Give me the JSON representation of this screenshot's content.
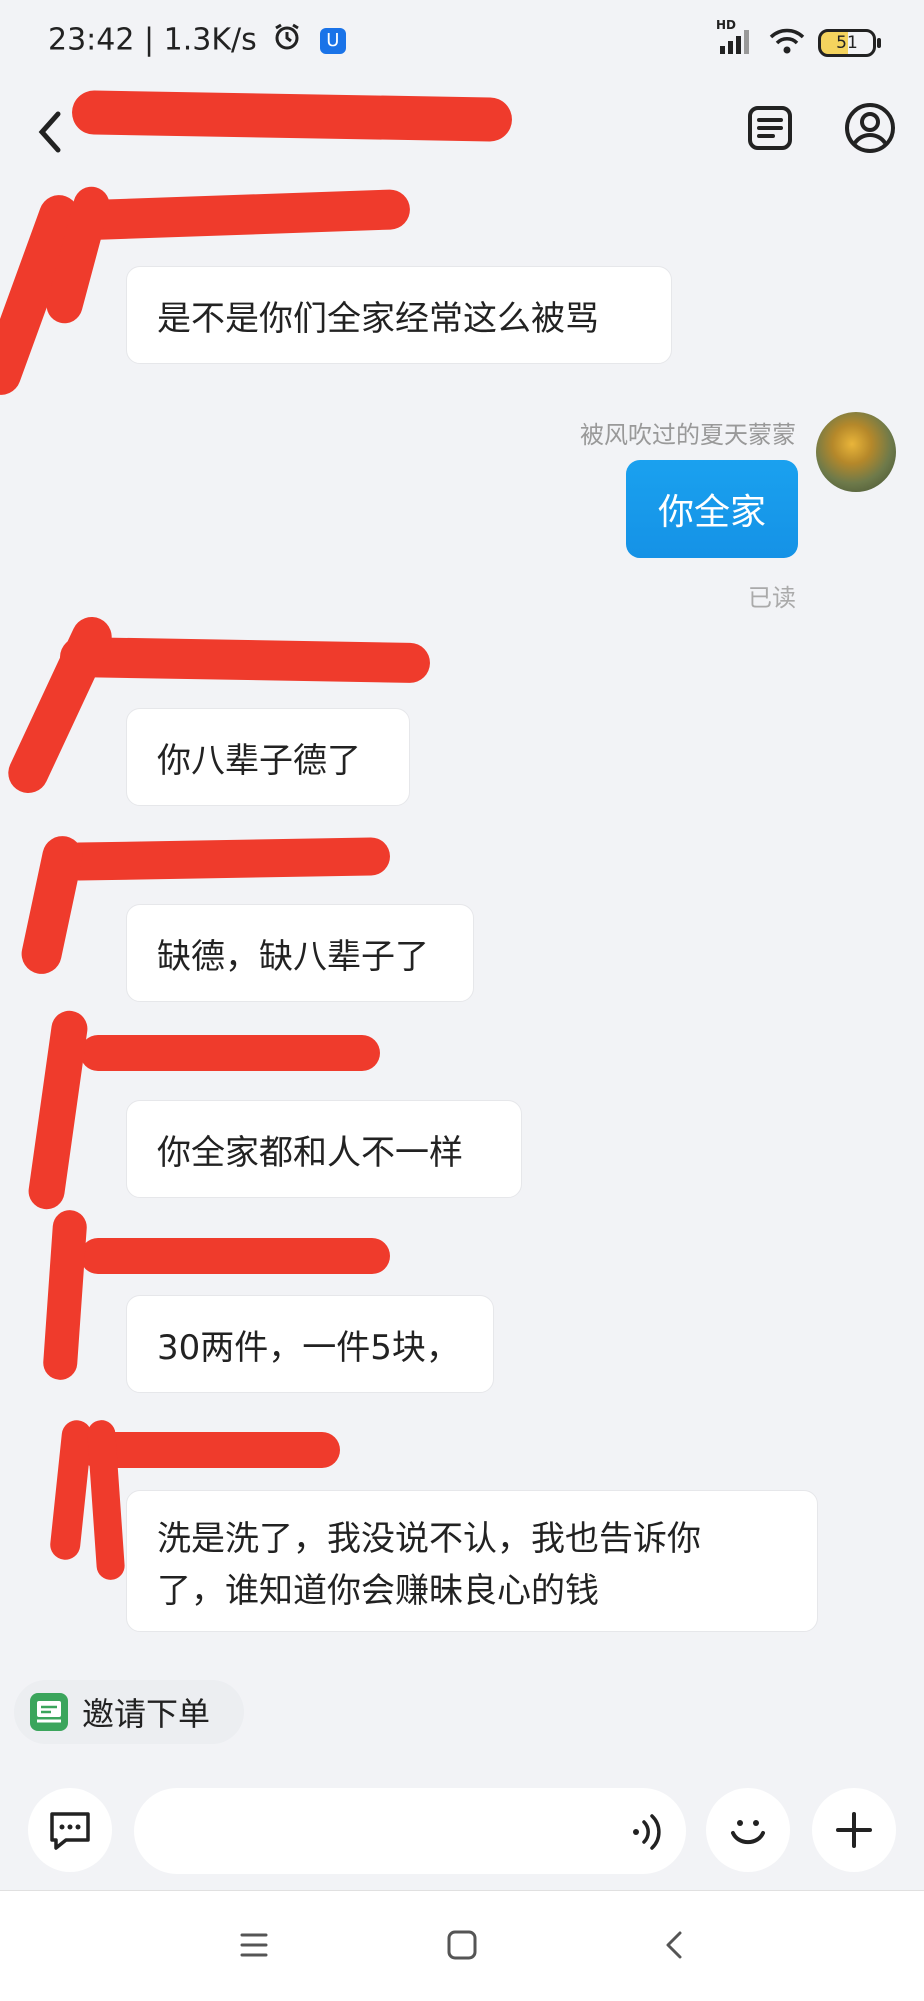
{
  "status_bar": {
    "time": "23:42",
    "speed": "1.3K/s",
    "network": "HD",
    "battery": "51"
  },
  "header": {
    "back_icon": "chevron-left-icon",
    "order_icon": "order-list-icon",
    "profile_icon": "user-profile-icon"
  },
  "messages": [
    {
      "side": "left",
      "text": "是不是你们全家经常这么被骂"
    },
    {
      "side": "right",
      "sender": "被风吹过的夏天蒙蒙",
      "text": "你全家",
      "read_status": "已读"
    },
    {
      "side": "left",
      "text": "你八辈子德了"
    },
    {
      "side": "left",
      "text": "缺德，缺八辈子了"
    },
    {
      "side": "left",
      "text": "你全家都和人不一样"
    },
    {
      "side": "left",
      "text": "30两件，一件5块，"
    },
    {
      "side": "left",
      "text_line1": "洗是洗了，我没说不认，我也告诉你",
      "text_line2": "了，谁知道你会赚昧良心的钱"
    }
  ],
  "invite": {
    "label": "邀请下单",
    "icon": "invite-order-icon"
  },
  "input_bar": {
    "chat_icon": "chat-bubble-icon",
    "voice_icon": "voice-wave-icon",
    "emoji_icon": "emoji-smile-icon",
    "plus_icon": "plus-icon"
  },
  "nav": {
    "menu_icon": "menu-icon",
    "home_icon": "home-square-icon",
    "back_icon": "back-triangle-icon"
  },
  "colors": {
    "redaction": "#ef3b2c",
    "my_bubble": "#1aa1ef",
    "background": "#f2f3f6"
  }
}
